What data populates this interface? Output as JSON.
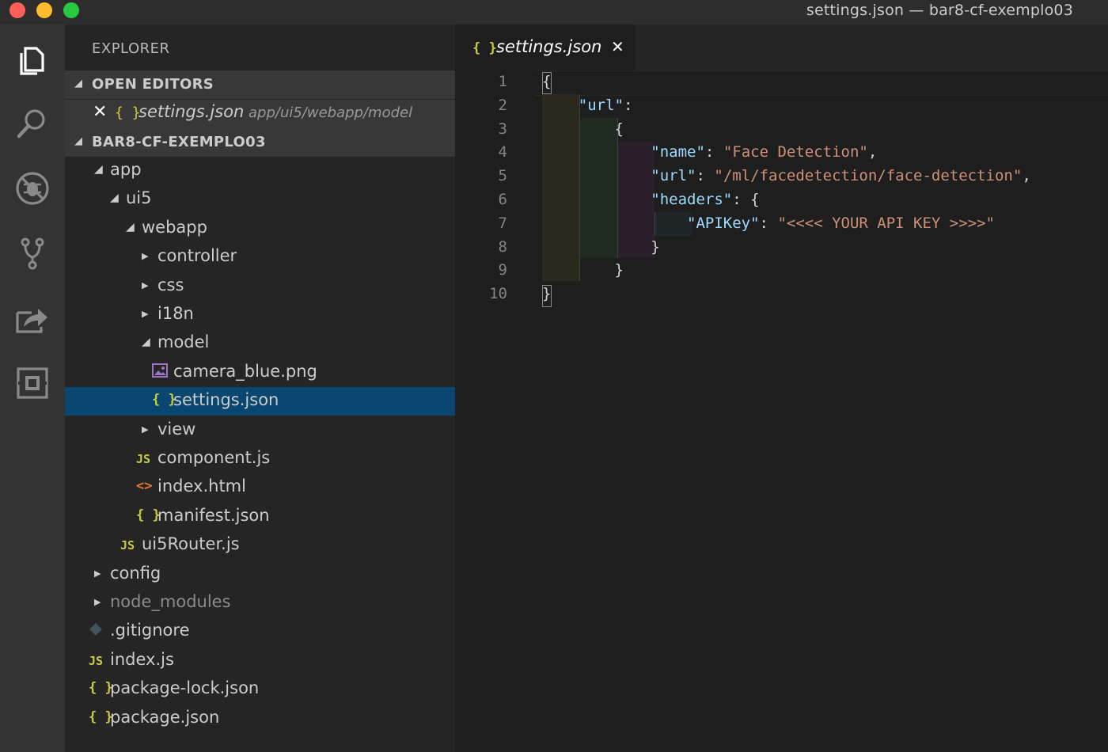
{
  "window": {
    "title": "settings.json — bar8-cf-exemplo03"
  },
  "activity_bar": {
    "items": [
      {
        "name": "explorer-icon"
      },
      {
        "name": "search-icon"
      },
      {
        "name": "debug-icon"
      },
      {
        "name": "source-control-icon"
      },
      {
        "name": "live-share-icon"
      },
      {
        "name": "extensions-icon"
      }
    ]
  },
  "sidebar": {
    "title": "EXPLORER",
    "open_editors": {
      "header": "OPEN EDITORS",
      "items": [
        {
          "name": "settings.json",
          "path": "app/ui5/webapp/model",
          "icon": "{ }",
          "close": "✕"
        }
      ]
    },
    "project": {
      "header": "BAR8-CF-EXEMPLO03",
      "tree": [
        {
          "label": "app",
          "type": "folder",
          "expanded": true
        },
        {
          "label": "ui5",
          "type": "folder",
          "expanded": true
        },
        {
          "label": "webapp",
          "type": "folder",
          "expanded": true
        },
        {
          "label": "controller",
          "type": "folder",
          "expanded": false
        },
        {
          "label": "css",
          "type": "folder",
          "expanded": false
        },
        {
          "label": "i18n",
          "type": "folder",
          "expanded": false
        },
        {
          "label": "model",
          "type": "folder",
          "expanded": true
        },
        {
          "label": "camera_blue.png",
          "type": "image"
        },
        {
          "label": "settings.json",
          "type": "json",
          "selected": true
        },
        {
          "label": "view",
          "type": "folder",
          "expanded": false
        },
        {
          "label": "component.js",
          "type": "js"
        },
        {
          "label": "index.html",
          "type": "html"
        },
        {
          "label": "manifest.json",
          "type": "json"
        },
        {
          "label": "ui5Router.js",
          "type": "js"
        },
        {
          "label": "config",
          "type": "folder",
          "expanded": false
        },
        {
          "label": "node_modules",
          "type": "folder",
          "expanded": false,
          "dimmed": true
        },
        {
          "label": ".gitignore",
          "type": "git"
        },
        {
          "label": "index.js",
          "type": "js"
        },
        {
          "label": "package-lock.json",
          "type": "json"
        },
        {
          "label": "package.json",
          "type": "json"
        }
      ]
    }
  },
  "icons": {
    "json": "{ }",
    "js": "JS",
    "html": "<>",
    "folder_collapsed": "▶",
    "folder_expanded": "◢",
    "close": "✕"
  },
  "editor": {
    "tab": {
      "label": "settings.json",
      "icon": "{ }",
      "close": "✕"
    },
    "line_numbers": [
      "1",
      "2",
      "3",
      "4",
      "5",
      "6",
      "7",
      "8",
      "9",
      "10"
    ],
    "lines": [
      [
        {
          "t": "{",
          "c": "punc"
        }
      ],
      [
        {
          "t": "    ",
          "c": "punc"
        },
        {
          "t": "\"url\"",
          "c": "key"
        },
        {
          "t": ":",
          "c": "punc"
        }
      ],
      [
        {
          "t": "        {",
          "c": "punc"
        }
      ],
      [
        {
          "t": "            ",
          "c": "punc"
        },
        {
          "t": "\"name\"",
          "c": "key"
        },
        {
          "t": ": ",
          "c": "punc"
        },
        {
          "t": "\"Face Detection\"",
          "c": "str"
        },
        {
          "t": ",",
          "c": "punc"
        }
      ],
      [
        {
          "t": "            ",
          "c": "punc"
        },
        {
          "t": "\"url\"",
          "c": "key"
        },
        {
          "t": ": ",
          "c": "punc"
        },
        {
          "t": "\"/ml/facedetection/face-detection\"",
          "c": "str"
        },
        {
          "t": ",",
          "c": "punc"
        }
      ],
      [
        {
          "t": "            ",
          "c": "punc"
        },
        {
          "t": "\"headers\"",
          "c": "key"
        },
        {
          "t": ": {",
          "c": "punc"
        }
      ],
      [
        {
          "t": "                ",
          "c": "punc"
        },
        {
          "t": "\"APIKey\"",
          "c": "key"
        },
        {
          "t": ": ",
          "c": "punc"
        },
        {
          "t": "\"<<<< YOUR API KEY >>>>\"",
          "c": "str"
        }
      ],
      [
        {
          "t": "            }",
          "c": "punc"
        }
      ],
      [
        {
          "t": "        }",
          "c": "punc"
        }
      ],
      [
        {
          "t": "}",
          "c": "punc"
        }
      ]
    ]
  },
  "colors": {
    "accent": "#094771",
    "json_icon": "#cbcb41",
    "key": "#9cdcfe",
    "string": "#ce9178"
  }
}
